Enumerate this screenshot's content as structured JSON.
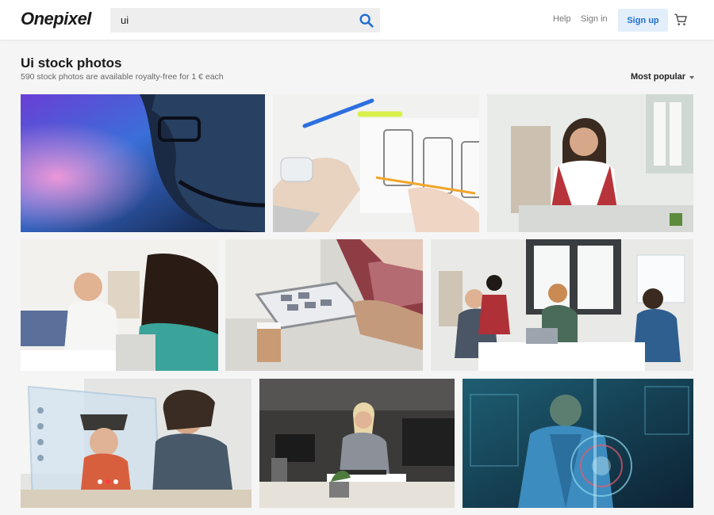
{
  "header": {
    "logo": "Onepixel",
    "search": {
      "value": "ui",
      "icon": "search-icon"
    },
    "help": "Help",
    "signin": "Sign in",
    "signup": "Sign up",
    "cart_icon": "cart-icon"
  },
  "main": {
    "title": "Ui stock photos",
    "subtitle": "590 stock photos are available royalty-free for 1 € each",
    "sort": {
      "value": "Most popular",
      "icon": "caret-down-icon"
    }
  },
  "colors": {
    "accent": "#1f6fd1",
    "signup_bg": "#e3eefb"
  }
}
